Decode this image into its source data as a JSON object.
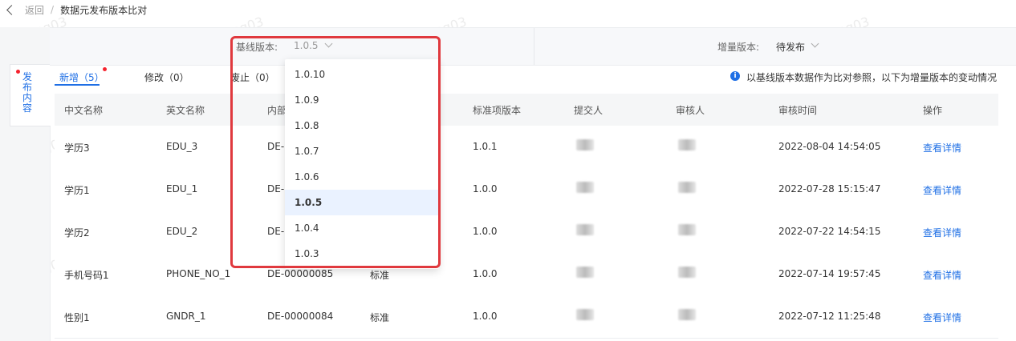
{
  "breadcrumb": {
    "back": "返回",
    "sep": "/",
    "title": "数据元发布版本比对"
  },
  "topbar": {
    "baseline_label": "基线版本:",
    "baseline_value": "1.0.5",
    "incremental_label": "增量版本:",
    "incremental_value": "待发布"
  },
  "sidetab": {
    "label": "发布内容"
  },
  "tabs": [
    {
      "label": "新增（5）",
      "active": true
    },
    {
      "label": "修改（0）",
      "active": false
    },
    {
      "label": "废止（0）",
      "active": false
    }
  ],
  "info": {
    "icon": "info-icon",
    "text": "以基线版本数据作为比对参照，以下为增量版本的变动情况"
  },
  "table": {
    "headers": [
      "中文名称",
      "英文名称",
      "内部",
      "",
      "标准项版本",
      "提交人",
      "审核人",
      "审核时间",
      "操作"
    ],
    "rows": [
      {
        "cn": "学历3",
        "en": "EDU_3",
        "code": "DE-",
        "type": "",
        "ver": "1.0.1",
        "time": "2022-08-04 14:54:05",
        "op": "查看详情"
      },
      {
        "cn": "学历1",
        "en": "EDU_1",
        "code": "DE-",
        "type": "",
        "ver": "1.0.0",
        "time": "2022-07-28 15:15:47",
        "op": "查看详情"
      },
      {
        "cn": "学历2",
        "en": "EDU_2",
        "code": "DE-",
        "type": "",
        "ver": "1.0.0",
        "time": "2022-07-22 14:54:15",
        "op": "查看详情"
      },
      {
        "cn": "手机号码1",
        "en": "PHONE_NO_1",
        "code": "DE-00000085",
        "type": "标准",
        "ver": "1.0.0",
        "time": "2022-07-14 19:57:45",
        "op": "查看详情"
      },
      {
        "cn": "性别1",
        "en": "GNDR_1",
        "code": "DE-00000084",
        "type": "标准",
        "ver": "1.0.0",
        "time": "2022-07-12 11:25:48",
        "op": "查看详情"
      }
    ]
  },
  "dropdown": {
    "options": [
      "1.0.10",
      "1.0.9",
      "1.0.8",
      "1.0.7",
      "1.0.6",
      "1.0.5",
      "1.0.4",
      "1.0.3"
    ],
    "selected": "1.0.5"
  },
  "watermark": "fuzheng03",
  "colors": {
    "accent": "#1f6fe5",
    "highlight": "#e0393e",
    "dot": "#f5222d"
  }
}
